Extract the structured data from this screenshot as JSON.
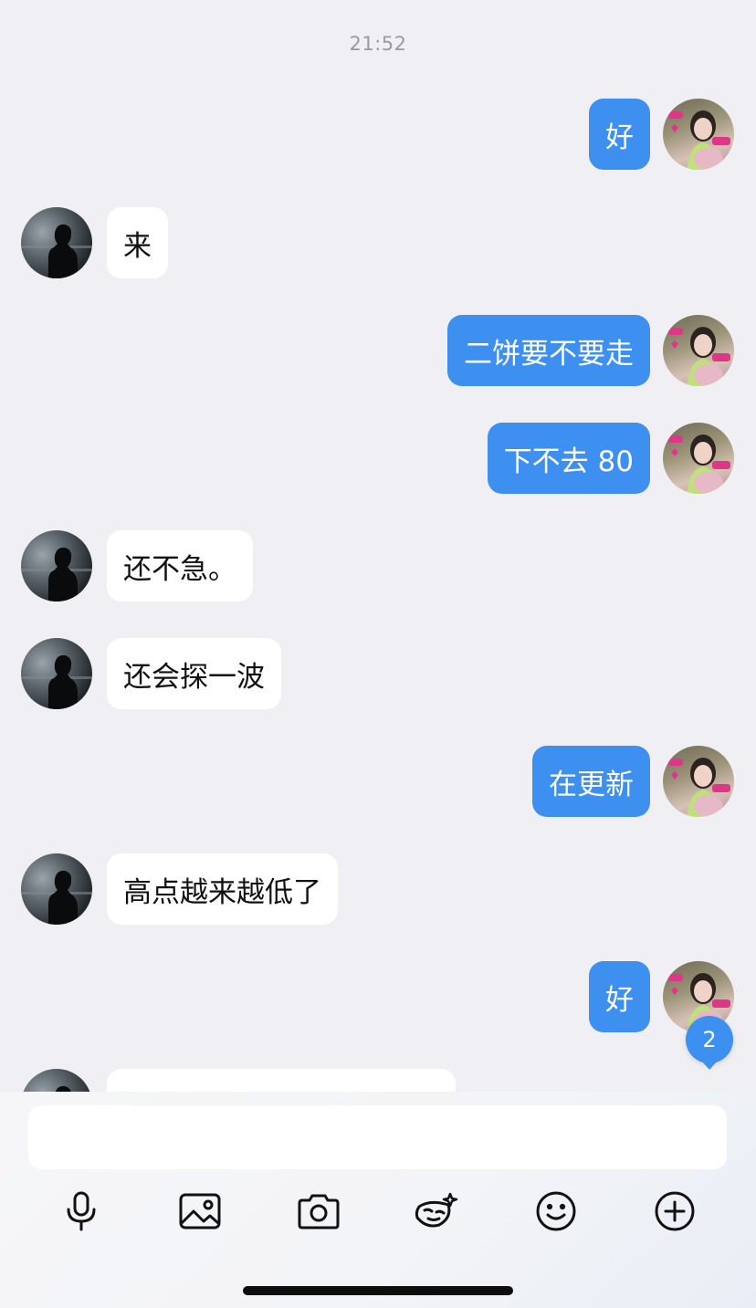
{
  "chat": {
    "timestamp": "21:52",
    "messages": [
      {
        "side": "out",
        "text": "好"
      },
      {
        "side": "in",
        "text": "来"
      },
      {
        "side": "out",
        "text": "二饼要不要走"
      },
      {
        "side": "out",
        "text": "下不去 80"
      },
      {
        "side": "in",
        "text": "还不急。"
      },
      {
        "side": "in",
        "text": "还会探一波"
      },
      {
        "side": "out",
        "text": "在更新"
      },
      {
        "side": "in",
        "text": "高点越来越低了"
      },
      {
        "side": "out",
        "text": "好"
      }
    ],
    "unread_count": "2"
  },
  "composer": {
    "input_value": "",
    "tools": [
      "microphone-icon",
      "image-icon",
      "camera-icon",
      "sticker-icon",
      "emoji-icon",
      "plus-icon"
    ]
  },
  "colors": {
    "background": "#efeff4",
    "outgoing_bubble": "#3d8ff0",
    "incoming_bubble": "#ffffff",
    "timestamp": "#9a9aa0"
  }
}
